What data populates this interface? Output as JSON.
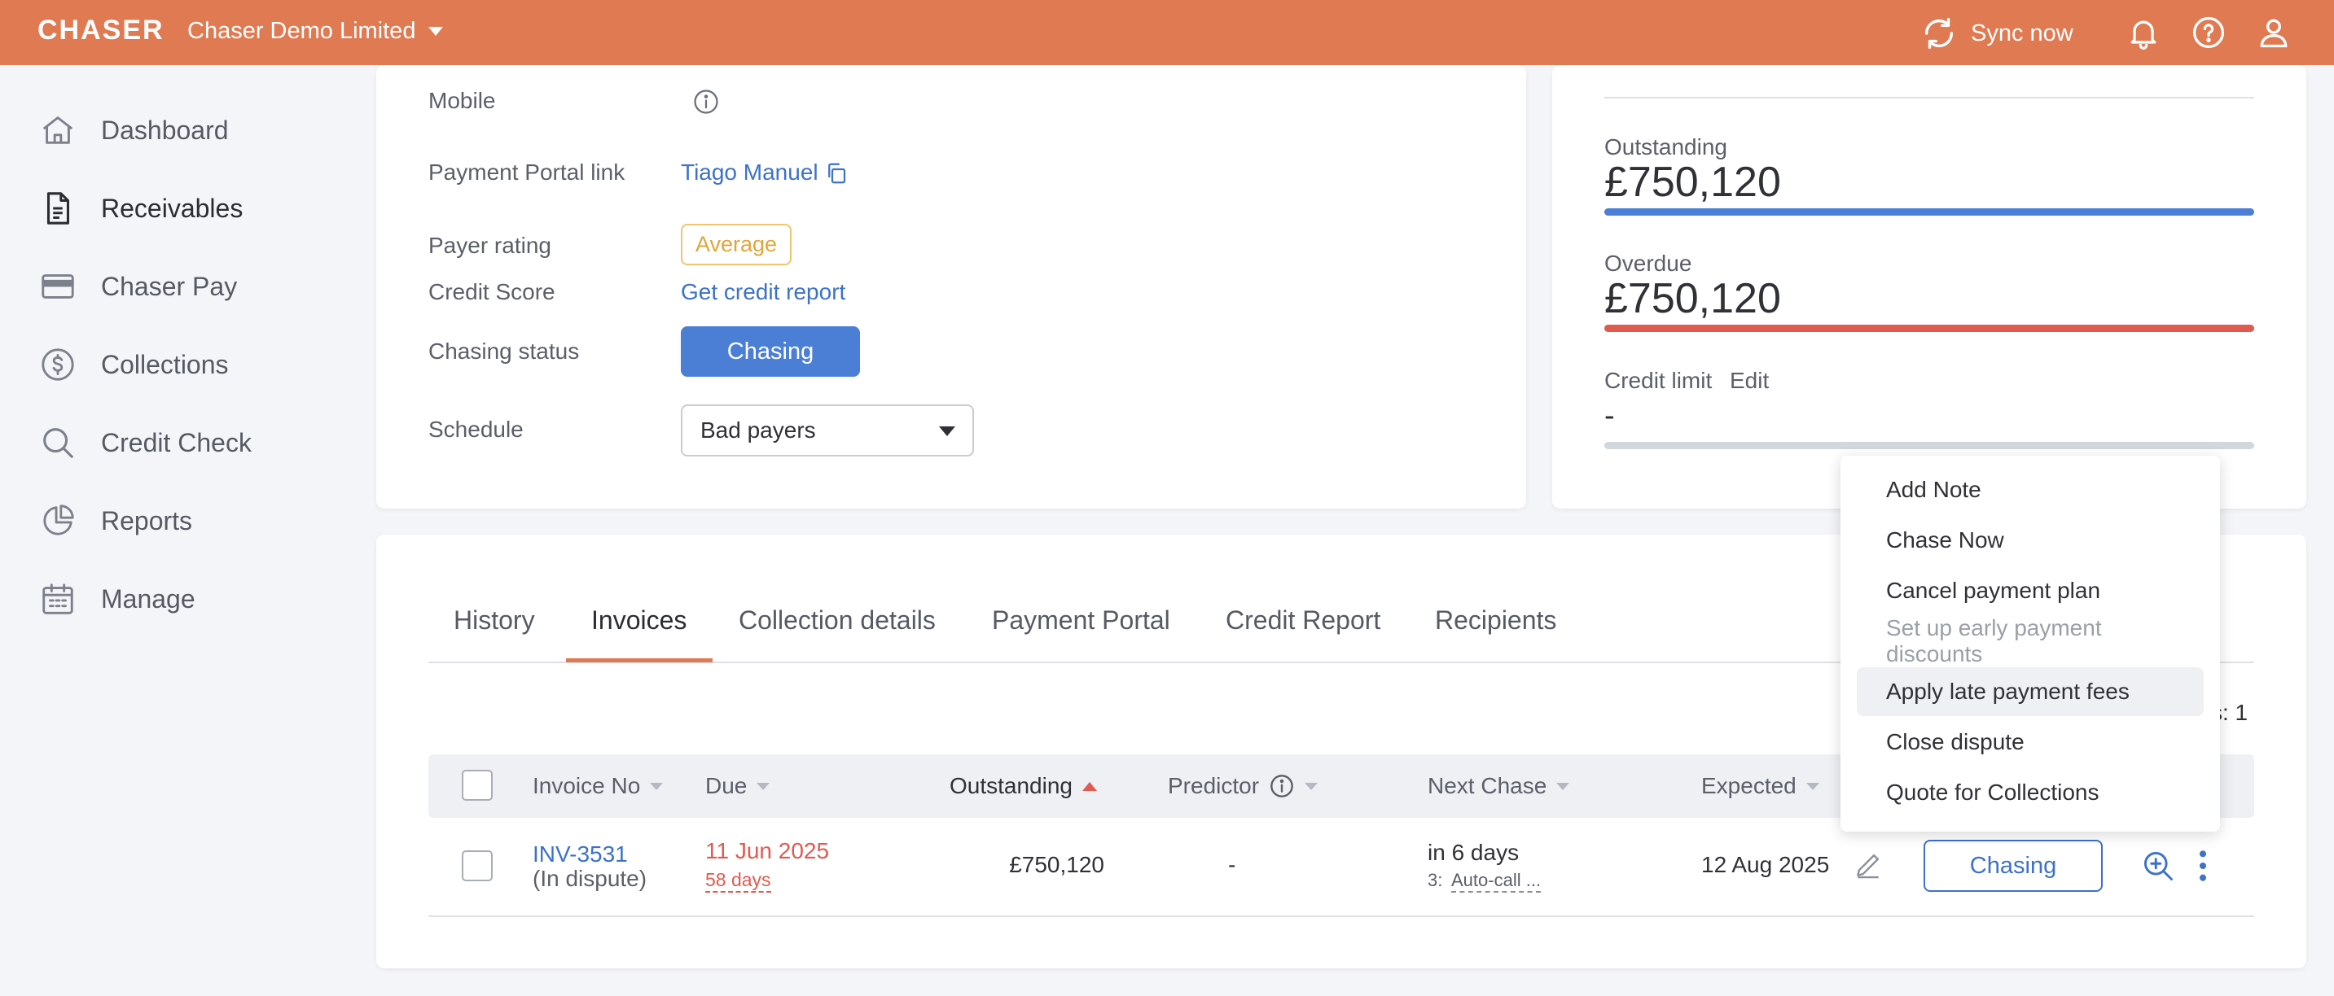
{
  "topbar": {
    "logo": "CHASER",
    "org_name": "Chaser Demo Limited",
    "sync_label": "Sync now",
    "icons": [
      "sync-icon",
      "bell-icon",
      "help-icon",
      "user-icon"
    ]
  },
  "sidebar": {
    "items": [
      {
        "label": "Dashboard",
        "icon": "home-icon"
      },
      {
        "label": "Receivables",
        "icon": "document-icon",
        "active": true
      },
      {
        "label": "Chaser Pay",
        "icon": "card-icon"
      },
      {
        "label": "Collections",
        "icon": "dollar-circle-icon"
      },
      {
        "label": "Credit Check",
        "icon": "search-icon"
      },
      {
        "label": "Reports",
        "icon": "pie-chart-icon"
      },
      {
        "label": "Manage",
        "icon": "calendar-icon"
      }
    ]
  },
  "details": {
    "mobile_label": "Mobile",
    "portal_label": "Payment Portal link",
    "portal_link": "Tiago Manuel",
    "payer_rating_label": "Payer rating",
    "payer_rating": "Average",
    "credit_score_label": "Credit Score",
    "credit_score_link": "Get credit report",
    "chasing_status_label": "Chasing status",
    "chasing_status": "Chasing",
    "schedule_label": "Schedule",
    "schedule_value": "Bad payers"
  },
  "summary": {
    "outstanding_label": "Outstanding",
    "outstanding_value": "£750,120",
    "outstanding_fill": 1.0,
    "overdue_label": "Overdue",
    "overdue_value": "£750,120",
    "overdue_fill": 1.0,
    "credit_limit_label": "Credit limit",
    "credit_limit_edit": "Edit",
    "credit_limit_value": "-"
  },
  "tabs": [
    {
      "label": "History"
    },
    {
      "label": "Invoices",
      "active": true
    },
    {
      "label": "Collection details"
    },
    {
      "label": "Payment Portal"
    },
    {
      "label": "Credit Report"
    },
    {
      "label": "Recipients"
    }
  ],
  "table": {
    "count_fragment": "s: 1",
    "headers": [
      "Invoice No",
      "Due",
      "Outstanding",
      "Predictor",
      "Next Chase",
      "Expected"
    ],
    "rows": [
      {
        "invoice_no": "INV-3531",
        "invoice_note": "(In dispute)",
        "due": "11 Jun 2025",
        "due_overdue": "58 days",
        "outstanding": "£750,120",
        "predictor": "-",
        "next_chase": "in 6 days",
        "next_chase_step_prefix": "3:",
        "next_chase_step": "Auto-call ...",
        "expected": "12 Aug 2025",
        "status_button": "Chasing"
      }
    ]
  },
  "menu": {
    "items": [
      {
        "label": "Add Note"
      },
      {
        "label": "Chase Now"
      },
      {
        "label": "Cancel payment plan"
      },
      {
        "label": "Set up early payment discounts",
        "disabled": true
      },
      {
        "label": "Apply late payment fees",
        "hover": true
      },
      {
        "label": "Close dispute"
      },
      {
        "label": "Quote for Collections"
      }
    ]
  },
  "colors": {
    "brand": "#e07a52",
    "primary": "#4b7fd6",
    "link": "#3d72c8",
    "overdue": "#e05a4f",
    "outstanding_bar": "#4b7fd6",
    "overdue_bar": "#e05a4f",
    "credit_bar": "#d2d6dd"
  }
}
